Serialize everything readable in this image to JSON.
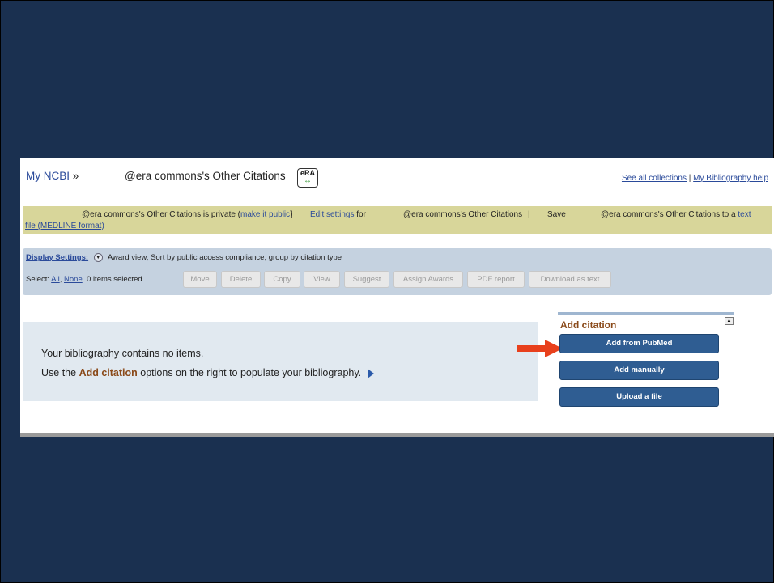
{
  "header": {
    "myncbi": "My NCBI",
    "sep": "»",
    "title": "@era commons's Other Citations",
    "era_logo": "eRA",
    "links": [
      "See all collections",
      "My Bibliography help"
    ],
    "link_sep": "|"
  },
  "notice": {
    "prefix": "@era commons's Other Citations is private (",
    "make_public": "make it public",
    "suffix": ")",
    "sep": "|",
    "edit_settings": "Edit settings",
    "for_text": "for",
    "title2": "@era commons's Other Citations",
    "save": "Save",
    "title3": "@era commons's Other Citations to a",
    "text_link": "text",
    "file_link": "file (MEDLINE format)"
  },
  "display_settings": {
    "label": "Display Settings:",
    "value": "Award view, Sort by public access compliance, group by citation type",
    "select_label": "Select:",
    "all": "All",
    "none": "None",
    "count": "0 items selected",
    "buttons": [
      "Move",
      "Delete",
      "Copy",
      "View",
      "Suggest",
      "Assign Awards",
      "PDF report",
      "Download as text"
    ]
  },
  "empty": {
    "line1": "Your bibliography contains no items.",
    "line2_pre": "Use the",
    "line2_em": "Add citation",
    "line2_post": "options on the right to populate your bibliography."
  },
  "add_citation": {
    "title": "Add citation",
    "buttons": [
      "Add from PubMed",
      "Add manually",
      "Upload a file"
    ]
  },
  "colors": {
    "background": "#1a3050",
    "notice_bar": "#d8d69a",
    "settings_bar": "#c5d2e0",
    "primary_button": "#2f5d92",
    "accent_arrow": "#e8401c"
  }
}
